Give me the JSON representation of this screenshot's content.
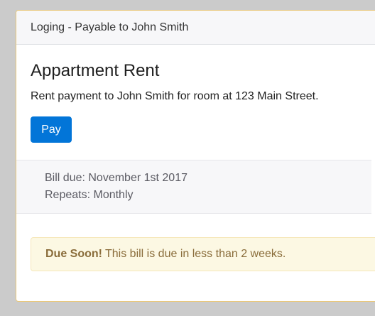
{
  "header": {
    "title": "Loging - Payable to John Smith"
  },
  "bill": {
    "title": "Appartment Rent",
    "description": "Rent payment to John Smith for room at 123 Main Street.",
    "pay_label": "Pay",
    "due_line": "Bill due: November 1st 2017",
    "repeats_line": "Repeats: Monthly"
  },
  "alert": {
    "strong": "Due Soon!",
    "text": "This bill is due in less than 2 weeks."
  },
  "colors": {
    "primary": "#0275d8",
    "warning_bg": "#fcf8e3",
    "warning_text": "#8a6d3b",
    "card_border": "#e9c879"
  }
}
